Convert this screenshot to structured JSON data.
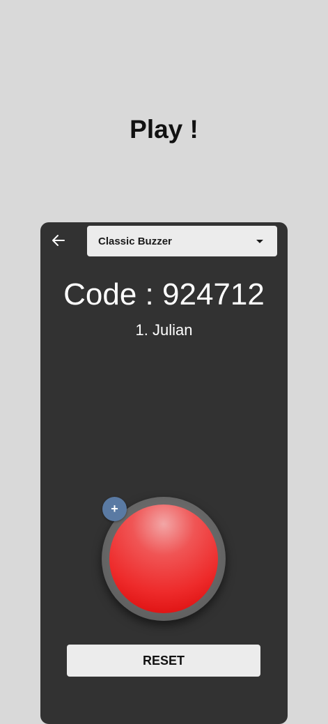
{
  "page": {
    "title": "Play !"
  },
  "panel": {
    "game_mode": {
      "selected": "Classic Buzzer"
    },
    "code": {
      "label": "Code : ",
      "value": "924712"
    },
    "players": [
      "1. Julian"
    ],
    "add_button_label": "+",
    "reset_label": "RESET"
  },
  "icons": {
    "back": "arrow-left-icon",
    "dropdown": "caret-down-icon",
    "add": "plus-icon"
  },
  "colors": {
    "background": "#d9d9d9",
    "panel": "#323232",
    "buzzer": "#ee2b2b",
    "add_button": "#5a7aa3",
    "button_surface": "#ececec"
  }
}
